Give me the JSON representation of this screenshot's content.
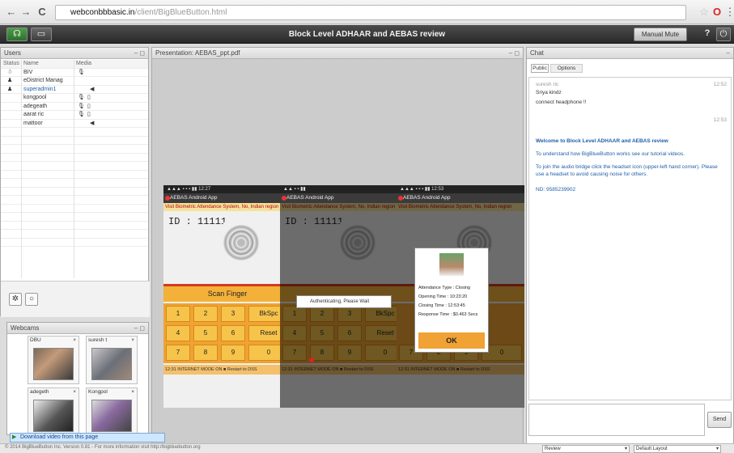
{
  "browser": {
    "url_host": "webconbbbasic.in",
    "url_path": "/client/BigBlueButton.html"
  },
  "appbar": {
    "title": "Block Level ADHAAR and AEBAS review",
    "manual_label": "Manual Mute",
    "help_label": "?"
  },
  "users": {
    "title": "Users",
    "headers": [
      "Status",
      "Name",
      "Media"
    ],
    "rows": [
      {
        "name": "BIV",
        "status": "presenter",
        "mic": true,
        "cam": false
      },
      {
        "name": "eDistrict Manag",
        "status": "user",
        "mic": false,
        "cam": false
      },
      {
        "name": "superadmin1",
        "status": "user",
        "mic": false,
        "cam": false,
        "speaker": true
      },
      {
        "name": "kongpool",
        "status": "",
        "mic": true,
        "cam": true
      },
      {
        "name": "adegeath",
        "status": "",
        "mic": true,
        "cam": true
      },
      {
        "name": "aarat ric",
        "status": "",
        "mic": true,
        "cam": true
      },
      {
        "name": "mattoor",
        "status": "",
        "mic": false,
        "cam": false,
        "speaker": true
      }
    ]
  },
  "webcams": {
    "title": "Webcams",
    "tiles": [
      "DBU",
      "suresh t",
      "adegeth",
      "Kongpol"
    ]
  },
  "presentation": {
    "title": "Presentation: AEBAS_ppt.pdf",
    "app_title": "AEBAS Android App",
    "banner": "Visit Biometric Attendance System, No, Indian region",
    "id_label": "ID :",
    "id_value": "111111",
    "scan_label": "Scan Finger",
    "keys": [
      "1",
      "2",
      "3",
      "BkSpc",
      "4",
      "5",
      "6",
      "Reset",
      "7",
      "8",
      "9",
      "0"
    ],
    "footer": "12:31   INTERNET MODE ON ■ Restart to DSS",
    "auth_msg": "Authenticating, Please Wait",
    "dialog": {
      "att_type": "Attendance Type : Closing",
      "opening": "Opening Time : 10:23:20",
      "closing": "Closing Time : 12:53:45",
      "response": "Response Time : $0.463 Secs",
      "ok_label": "OK"
    }
  },
  "chat": {
    "title": "Chat",
    "tabs": [
      "Public",
      "Options"
    ],
    "messages": [
      {
        "author": "suresh ric",
        "time": "12:52",
        "text": "Sriya kindz"
      },
      {
        "author": "",
        "time": "",
        "text": "connect headphone !!"
      },
      {
        "author": "",
        "time": "12:53",
        "text": ""
      },
      {
        "author": "",
        "time": "",
        "text": "Welcome to Block Level ADHAAR and AEBAS review"
      },
      {
        "author": "",
        "time": "",
        "text": "To understand how BigBlueButton works see our tutorial videos."
      },
      {
        "author": "",
        "time": "",
        "text": "To join the audio bridge click the headset icon (upper-left hand corner). Please use a headset to avoid causing noise for others."
      },
      {
        "author": "",
        "time": "",
        "text": "ND: 9585239902"
      }
    ],
    "send_label": "Send"
  },
  "download_banner": "Download video from this page",
  "status_bar": {
    "text": "© 2014 BigBlueButton Inc. Version 0.81 - For more information visit http://bigbluebutton.org",
    "layout_select": "Review",
    "layout_select2": "Default Layout"
  }
}
